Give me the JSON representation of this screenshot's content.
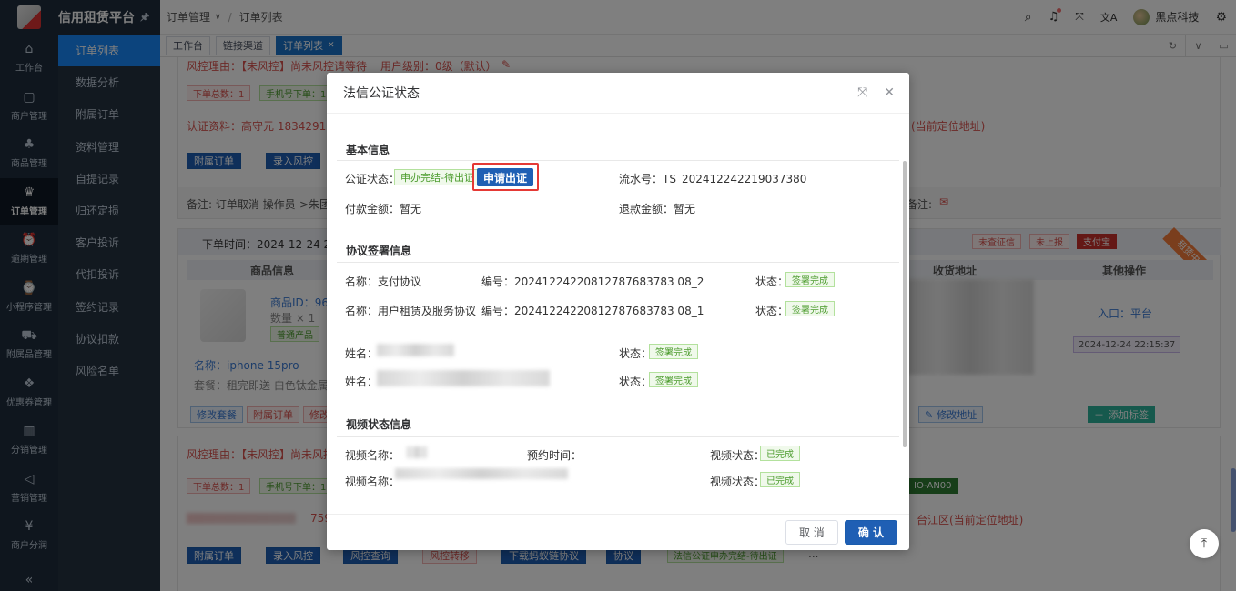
{
  "brand": {
    "title": "信用租赁平台",
    "pin": "🖈"
  },
  "icon_nav": [
    {
      "label": "工作台",
      "icon": "home-icon",
      "glyph": "⌂"
    },
    {
      "label": "商户管理",
      "icon": "shop-icon",
      "glyph": "▢"
    },
    {
      "label": "商品管理",
      "icon": "apple-icon",
      "glyph": "♣"
    },
    {
      "label": "订单管理",
      "icon": "trophy-icon",
      "glyph": "♛",
      "active": true
    },
    {
      "label": "逾期管理",
      "icon": "alarm-icon",
      "glyph": "⏰"
    },
    {
      "label": "小程序管理",
      "icon": "watch-icon",
      "glyph": "⌚"
    },
    {
      "label": "附属品管理",
      "icon": "cart-icon",
      "glyph": "⛟"
    },
    {
      "label": "优惠券管理",
      "icon": "gift-icon",
      "glyph": "❖"
    },
    {
      "label": "分销管理",
      "icon": "chart-icon",
      "glyph": "▥"
    },
    {
      "label": "营销管理",
      "icon": "megaphone-icon",
      "glyph": "◁"
    },
    {
      "label": "商户分润",
      "icon": "yen-icon",
      "glyph": "¥"
    }
  ],
  "collapse_glyph": "«",
  "sub_menu": [
    "订单列表",
    "数据分析",
    "附属订单",
    "资料管理",
    "自提记录",
    "归还定损",
    "客户投诉",
    "代扣投诉",
    "签约记录",
    "协议扣款",
    "风险名单"
  ],
  "header": {
    "breadcrumb_1": "订单管理",
    "breadcrumb_sep": "/",
    "breadcrumb_2": "订单列表",
    "user": "黑点科技"
  },
  "tags": [
    {
      "label": "工作台"
    },
    {
      "label": "链接渠道"
    },
    {
      "label": "订单列表",
      "active": true
    }
  ],
  "bg": {
    "risk_reason": "风控理由：【未风控】尚未风控请等待",
    "user_level": "用户级别：0级（默认）",
    "order_total": "下单总数：1",
    "phone_orders": "手机号下单：1",
    "auth_info": "认证资料：高守元  1834291634",
    "loc_right": "(当前定位地址)",
    "btn_sub_order": "附属订单",
    "btn_risk": "录入风控",
    "remark": "备注: 订单取消 操作员->朱团结",
    "remark_right": "备注:",
    "order_time": "下单时间：2024-12-24 22:08",
    "badge1": "未查征信",
    "badge2": "未上报",
    "badge3": "支付宝",
    "ribbon": "租赁中",
    "th_product": "商品信息",
    "th_address": "收货地址",
    "th_ops": "其他操作",
    "product_id": "商品ID：967",
    "qty": "数量 × 1",
    "prod_tag": "普通产品",
    "prod_name": "名称：iphone 15pro",
    "prod_pkg": "套餐：租完即送 白色钛金属 1",
    "entry": "入口：平台",
    "entry_time": "2024-12-24 22:15:37",
    "btn_mod_pkg": "修改套餐",
    "btn_sub_order2": "附属订单",
    "btn_mod_more": "修改",
    "btn_mod_addr": "修改地址",
    "btn_add_tag": "添加标签",
    "risk_reason2": "风控理由：【未风控】尚未风控",
    "order_total2": "下单总数：1",
    "phone_orders2": "手机号下单：1",
    "device": "IO-AN00",
    "loc2": "台江区(当前定位地址)",
    "num2": "759",
    "btn_sub_order3": "附属订单",
    "btn_risk2": "录入风控",
    "btn_risk_query": "风控查询",
    "btn_risk_trans": "风控转移",
    "btn_download": "下载蚂蚁链协议",
    "btn_protocol": "协议",
    "notary_tag": "法信公证申办完结-待出证",
    "more": "..."
  },
  "modal": {
    "title": "法信公证状态",
    "sec_basic": "基本信息",
    "notary_status_label": "公证状态：",
    "notary_status_value": "申办完结-待出证",
    "apply_button": "申请出证",
    "serial_label": "流水号：",
    "serial_value": "TS_202412242219037380",
    "pay_label": "付款金额：",
    "pay_value": "暂无",
    "refund_label": "退款金额：",
    "refund_value": "暂无",
    "sec_agreement": "协议签署信息",
    "agreements": [
      {
        "name_label": "名称：",
        "name": "支付协议",
        "no_label": "编号：",
        "no": "20241224220812787683783 08_2",
        "status_label": "状态：",
        "status": "签署完成"
      },
      {
        "name_label": "名称：",
        "name": "用户租赁及服务协议",
        "no_label": "编号：",
        "no": "20241224220812787683783 08_1",
        "status_label": "状态：",
        "status": "签署完成"
      }
    ],
    "signers": [
      {
        "name_label": "姓名：",
        "status_label": "状态：",
        "status": "签署完成"
      },
      {
        "name_label": "姓名：",
        "status_label": "状态：",
        "status": "签署完成"
      }
    ],
    "sec_video": "视频状态信息",
    "video_name_label": "视频名称：",
    "appoint_label": "预约时间：",
    "video_status_label": "视频状态：",
    "video_status": "已完成",
    "video_name_label2": "视频名称：",
    "video_status_label2": "视频状态：",
    "video_status2": "已完成",
    "cancel": "取 消",
    "confirm": "确 认"
  }
}
